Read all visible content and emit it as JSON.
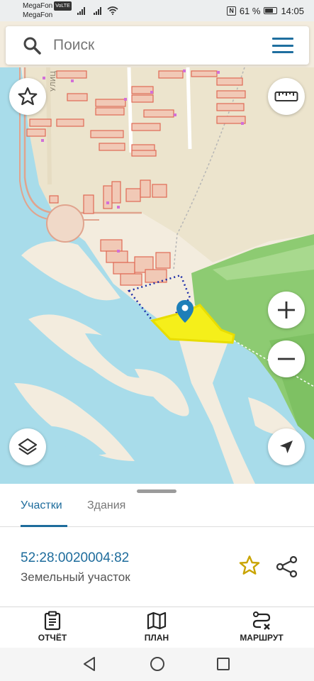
{
  "status_bar": {
    "carrier_1": "MegaFon",
    "carrier_1_badge": "VoLTE",
    "carrier_2": "MegaFon",
    "nfc": "N",
    "battery": "61 %",
    "time": "14:05"
  },
  "search": {
    "placeholder": "Поиск"
  },
  "map": {
    "street_label": "УЛИЦ",
    "colors": {
      "water": "#a8dcea",
      "land": "#f3ecde",
      "settlement": "#eae3cf",
      "forest": "#8dcb72",
      "selected_parcel": "#f5ef1a",
      "parcel_outline": "#e06a55",
      "pin": "#1e7fb8"
    }
  },
  "sheet": {
    "tabs": [
      {
        "label": "Участки",
        "active": true
      },
      {
        "label": "Здания",
        "active": false
      }
    ],
    "cadastral_number": "52:28:0020004:82",
    "parcel_type": "Земельный участок"
  },
  "actions": [
    {
      "label": "ОТЧЁТ",
      "icon": "report-icon"
    },
    {
      "label": "ПЛАН",
      "icon": "map-plan-icon"
    },
    {
      "label": "МАРШРУТ",
      "icon": "route-icon"
    }
  ]
}
